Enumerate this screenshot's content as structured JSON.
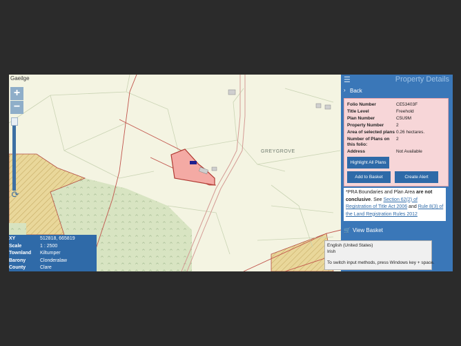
{
  "map": {
    "language_link": "Gaeilge",
    "zoom_in_label": "+",
    "zoom_out_label": "−",
    "place_label": "GREYGROVE"
  },
  "info_box": {
    "rows": [
      {
        "key": "XY",
        "value": "512818, 665819"
      },
      {
        "key": "Scale",
        "value": "1 : 2500"
      },
      {
        "key": "Townland",
        "value": "Kiltumper"
      },
      {
        "key": "Barony",
        "value": "Clonderalaw"
      },
      {
        "key": "County",
        "value": "Clare"
      }
    ]
  },
  "panel": {
    "title": "Property Details",
    "back_label": "Back",
    "details": [
      {
        "key": "Folio Number",
        "value": "CE53403F"
      },
      {
        "key": "Title Level",
        "value": "Freehold"
      },
      {
        "key": "Plan Number",
        "value": "C5U9M"
      },
      {
        "key": "Property Number",
        "value": "2"
      },
      {
        "key": "Area of selected plans",
        "value": "0.26 hectares."
      },
      {
        "key": "Number of Plans on",
        "value": "2"
      },
      {
        "key": "this folio:",
        "value": ""
      },
      {
        "key": "Address",
        "value": "Not Available"
      }
    ],
    "highlight_label": "Highlight All Plans",
    "add_basket_label": "Add to Basket",
    "create_alert_label": "Create Alert",
    "note": {
      "prefix": "*PRA Boundaries and Plan Area ",
      "bold": "are not conclusive",
      "mid": ". See ",
      "link1": "Section 62(2) of Registration of Title Act 2006",
      "and": " and ",
      "link2": "Rule 8(3) of the Land Registration Rules 2012"
    },
    "view_basket_label": "View Basket"
  },
  "tooltip": {
    "line1": "English (United States)",
    "line2": "Irish",
    "line3": "To switch input methods, press Windows key + space."
  },
  "colors": {
    "panel_bg": "#3a77b8",
    "details_bg": "#f7d6d8",
    "parcel_fill": "#f4aaa4",
    "boundary": "#c0524a"
  }
}
